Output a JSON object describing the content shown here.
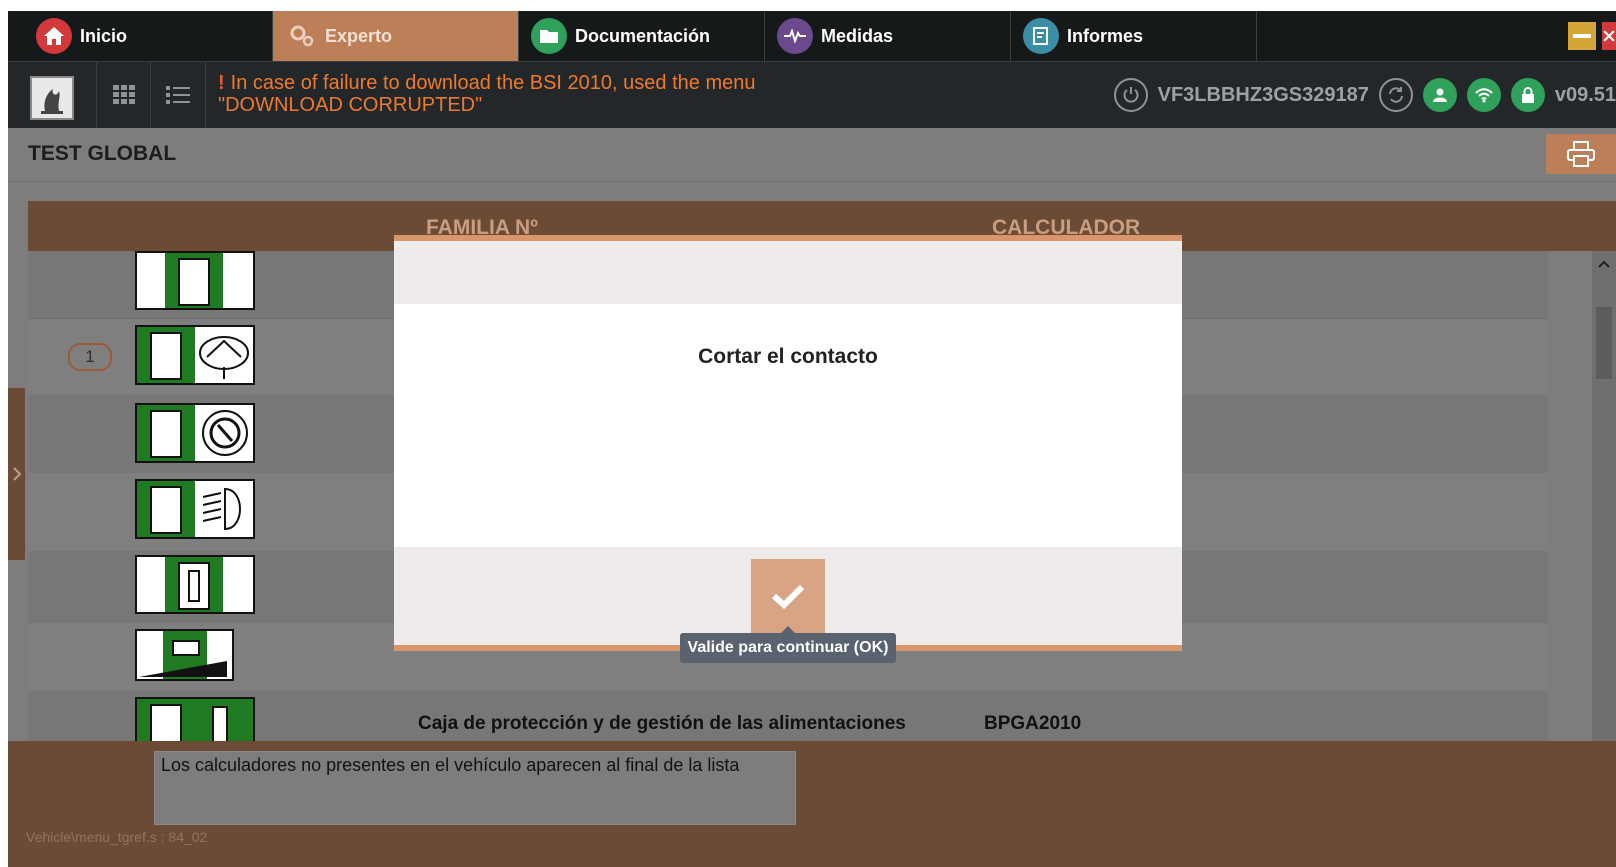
{
  "nav": {
    "tabs": [
      {
        "label": "Inicio",
        "icon": "home-icon",
        "color": "#d3393b"
      },
      {
        "label": "Experto",
        "icon": "gears-icon",
        "color": "#bd7f57"
      },
      {
        "label": "Documentación",
        "icon": "folder-icon",
        "color": "#2fa15a"
      },
      {
        "label": "Medidas",
        "icon": "waveform-icon",
        "color": "#6a4a8c"
      },
      {
        "label": "Informes",
        "icon": "report-icon",
        "color": "#3b8ea5"
      }
    ]
  },
  "infobar": {
    "warning_line1": "In case of failure to download the BSI 2010, used the menu",
    "warning_line2": "\"DOWNLOAD CORRUPTED\"",
    "vin": "VF3LBBHZ3GS329187",
    "version": "v09.51"
  },
  "page": {
    "title": "TEST GLOBAL",
    "columns": [
      "FAMILIA Nº",
      "CALCULADOR"
    ],
    "rows": [
      {
        "badge": "",
        "family": "",
        "calculator": ""
      },
      {
        "badge": "1",
        "family": "",
        "calculator": ""
      },
      {
        "badge": "",
        "family": "",
        "calculator": ""
      },
      {
        "badge": "",
        "family": "",
        "calculator": ""
      },
      {
        "badge": "",
        "family": "",
        "calculator": ""
      },
      {
        "badge": "",
        "family": "",
        "calculator": ""
      },
      {
        "badge": "",
        "family": "Caja de protección y de gestión de las alimentaciones",
        "calculator": "BPGA2010"
      }
    ]
  },
  "footer": {
    "note": "Los calculadores no presentes en el vehículo aparecen al final de la lista",
    "path": "Vehicle\\menu_tgref.s : 84_02"
  },
  "modal": {
    "message": "Cortar el contacto",
    "ok_tooltip": "Valide para continuar (OK)"
  }
}
